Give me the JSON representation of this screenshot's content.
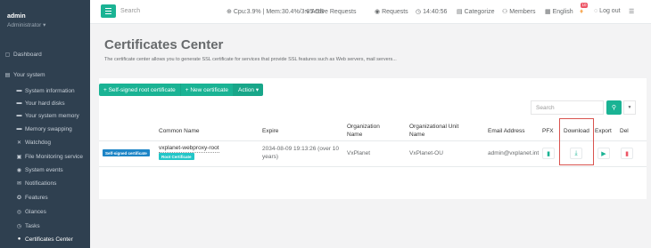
{
  "user": {
    "name": "admin",
    "role": "Administrator ▾"
  },
  "sidebar": {
    "items": [
      {
        "label": "Dashboard",
        "icon": "▢",
        "icon_name": "dashboard-icon"
      },
      {
        "label": "Your system",
        "icon": "▤",
        "icon_name": "system-icon"
      },
      {
        "label": "System information",
        "icon": "▬",
        "icon_name": "info-icon"
      },
      {
        "label": "Your hard disks",
        "icon": "▬",
        "icon_name": "disk-icon"
      },
      {
        "label": "Your system memory",
        "icon": "▬",
        "icon_name": "memory-icon"
      },
      {
        "label": "Memory swapping",
        "icon": "▬",
        "icon_name": "swap-icon"
      },
      {
        "label": "Watchdog",
        "icon": "✕",
        "icon_name": "watchdog-icon"
      },
      {
        "label": "File Monitoring service",
        "icon": "▣",
        "icon_name": "file-monitor-icon"
      },
      {
        "label": "System events",
        "icon": "◉",
        "icon_name": "events-icon"
      },
      {
        "label": "Notifications",
        "icon": "✉",
        "icon_name": "notifications-icon"
      },
      {
        "label": "Features",
        "icon": "✪",
        "icon_name": "features-icon"
      },
      {
        "label": "Glances",
        "icon": "◎",
        "icon_name": "glances-icon"
      },
      {
        "label": "Tasks",
        "icon": "◷",
        "icon_name": "tasks-icon"
      },
      {
        "label": "Certificates Center",
        "icon": "●",
        "icon_name": "certificates-icon"
      }
    ]
  },
  "topbar": {
    "search": "Search",
    "cpu": "Cpu:3.9% | Mem:30.4%/3.85 GB",
    "active_requests": "Active Requests",
    "requests": "Requests",
    "time": "14:40:56",
    "categorize": "Categorize",
    "members": "Members",
    "language": "English",
    "notif_count": "10",
    "logout": "Log out"
  },
  "page": {
    "title": "Certificates Center",
    "description": "The certificate center allows you to generate SSL certificate for services that provide SSL features such as Web servers, mail servers..."
  },
  "toolbar": {
    "self_signed": "+ Self-signed root certificate",
    "new_cert": "+ New certificate",
    "action": "Action ▾",
    "search_placeholder": "Search"
  },
  "table": {
    "headers": {
      "common_name": "Common Name",
      "expire": "Expire",
      "org_name_1": "Organization",
      "org_name_2": "Name",
      "org_unit_1": "Organizational Unit",
      "org_unit_2": "Name",
      "email": "Email Address",
      "pfx": "PFX",
      "download": "Download",
      "export": "Export",
      "del": "Del"
    },
    "row": {
      "type_badge": "Self-signed certificate",
      "common_name": "vxplanet-webproxy-root",
      "root_badge": "Root Certificate",
      "expire_1": "2034-08-09 19:13:26 (over 10",
      "expire_2": "years)",
      "org_name": "VxPlanet",
      "org_unit": "VxPlanet-OU",
      "email": "admin@vxplanet.int"
    }
  },
  "colors": {
    "sidebar": "#2f4050",
    "primary": "#1ab394",
    "info": "#1c84c6",
    "teal": "#23c6c8",
    "danger": "#ed5565",
    "highlight": "#d9534f"
  }
}
